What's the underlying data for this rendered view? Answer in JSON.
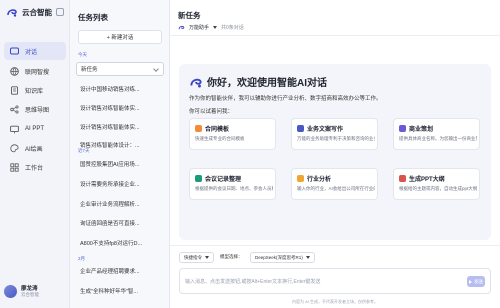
{
  "brand": {
    "name": "云合智能"
  },
  "nav": [
    {
      "label": "对话",
      "icon": "chat-icon",
      "active": true
    },
    {
      "label": "联网智搜",
      "icon": "globe-icon",
      "active": false
    },
    {
      "label": "知识库",
      "icon": "book-icon",
      "active": false
    },
    {
      "label": "思维导图",
      "icon": "mindmap-icon",
      "active": false
    },
    {
      "label": "AI PPT",
      "icon": "ppt-icon",
      "active": false
    },
    {
      "label": "AI绘画",
      "icon": "palette-icon",
      "active": false
    },
    {
      "label": "工作台",
      "icon": "workbench-icon",
      "active": false
    }
  ],
  "user": {
    "name": "廖龙涛",
    "org": "云合智能"
  },
  "list": {
    "title": "任务列表",
    "new_chat": "+ 新建对话",
    "groups": [
      {
        "label": "今天",
        "items": [
          "新任务",
          "设计中国移动销售对练...",
          "设计销售对练智能体实...",
          "设计销售对练智能体实...",
          "销售对练智能体设计：..."
        ]
      },
      {
        "label": "近7天",
        "items": [
          "国赞控股集团AI应用场...",
          "设计需要务所承接企业...",
          "企业审计业务流程解析...",
          "询证函回函是否可直接...",
          "A800不支持fp8对运行D..."
        ]
      },
      {
        "label": "2月",
        "items": [
          "企业产品经理招聘要求...",
          "生成\"全科种好年华\"智..."
        ]
      }
    ]
  },
  "main": {
    "title": "新任务",
    "agent_name": "万能助手",
    "agent_count": "共0条对话",
    "welcome_title": "你好，欢迎使用智能AI对话",
    "welcome_desc": "作为你的智能伙伴，我可以辅助你进行产业分析、数字招商和高效办公等工作。",
    "welcome_ask": "你可以试着问我：",
    "cards": [
      {
        "title": "合同模板",
        "desc": "快速生成专业的合同模板",
        "color": "#f28c3b"
      },
      {
        "title": "业务文案写作",
        "desc": "万能的业务助理专利于决策和咨询的业务文案",
        "color": "#4b59c6"
      },
      {
        "title": "商业策划",
        "desc": "提供具体商业名称。为您输出一份商业策划",
        "color": "#6a5ad8"
      },
      {
        "title": "会议记录整理",
        "desc": "根据提供的会议日期、地点、参会人员和会议要点快速整理",
        "color": "#1a9b7a"
      },
      {
        "title": "行业分析",
        "desc": "输入你的行业，AI会给出公司所在行业的基本术语、行业规模、生...",
        "color": "#f0a534"
      },
      {
        "title": "生成PPT大纲",
        "desc": "根据给的主题或内容，自动生成ppt大纲",
        "color": "#d9534f"
      }
    ]
  },
  "input": {
    "quick_cmd": "快捷指令",
    "model_label": "模型选择：",
    "model_value": "DeepSeek(深度思考R1)",
    "placeholder": "输入消息、点击发送按钮,或按Alt+Enter文本换行,Enter键发送",
    "send": "发送",
    "footer": "内容为 AI 生成，不代表开发者立场，仅供参考。"
  }
}
